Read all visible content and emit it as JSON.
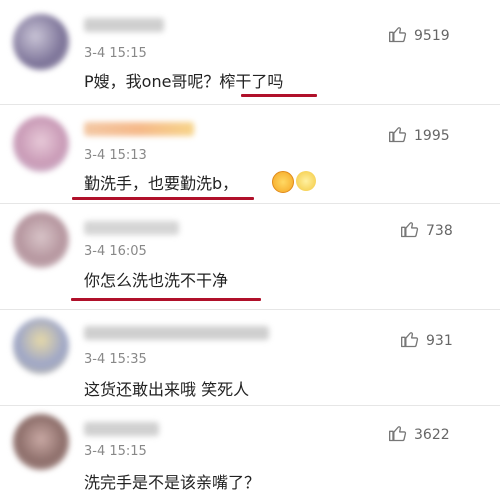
{
  "comments": [
    {
      "time": "3-4 15:15",
      "text": "P嫂，我one哥呢？榨干了吗",
      "likes": "9519"
    },
    {
      "time": "3-4 15:13",
      "text": "勤洗手，也要勤洗b，",
      "likes": "1995",
      "emojis": [
        "grimace-emoji",
        "celebration-emoji"
      ]
    },
    {
      "time": "3-4 16:05",
      "text": "你怎么洗也洗不干净",
      "likes": "738"
    },
    {
      "time": "3-4 15:35",
      "text": "这货还敢出来哦 笑死人",
      "likes": "931"
    },
    {
      "time": "3-4 15:15",
      "text": "洗完手是不是该亲嘴了？",
      "likes": "3622"
    }
  ],
  "colors": {
    "underline": "#b0102a",
    "divider": "#e6e6e6",
    "time": "#888888"
  }
}
